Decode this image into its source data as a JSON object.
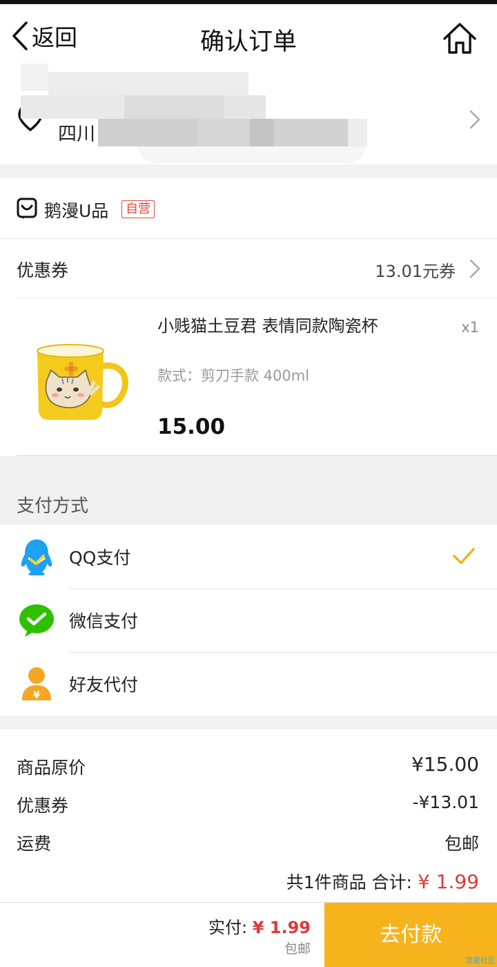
{
  "navbar": {
    "back_label": "返回",
    "title": "确认订单"
  },
  "address": {
    "text": "四川"
  },
  "store": {
    "name": "鹅漫U品",
    "badge": "自营"
  },
  "coupon": {
    "label": "优惠券",
    "value": "13.01元券"
  },
  "product": {
    "name": "小贱猫土豆君 表情同款陶瓷杯",
    "quantity": "x1",
    "spec": "款式：剪刀手款 400ml",
    "price": "15.00"
  },
  "payment": {
    "header": "支付方式",
    "options": [
      {
        "label": "QQ支付",
        "selected": true
      },
      {
        "label": "微信支付",
        "selected": false
      },
      {
        "label": "好友代付",
        "selected": false
      }
    ]
  },
  "summary": {
    "rows": [
      {
        "label": "商品原价",
        "value": "¥15.00"
      },
      {
        "label": "优惠券",
        "value": "-¥13.01"
      },
      {
        "label": "运费",
        "value": "包邮"
      }
    ],
    "total_prefix": "共1件商品  合计: ",
    "total_value": "¥ 1.99"
  },
  "bottom_bar": {
    "pay_label": "实付: ",
    "pay_value": "¥ 1.99",
    "shipping_note": "包邮",
    "button_label": "去付款"
  },
  "watermark": "流星社区",
  "colors": {
    "accent": "#f7b31c",
    "price_red": "#e0393b",
    "badge_red": "#e04a3f",
    "qq_blue": "#1da1f2",
    "wechat_green": "#2dc100",
    "friend_orange": "#f5a623"
  }
}
